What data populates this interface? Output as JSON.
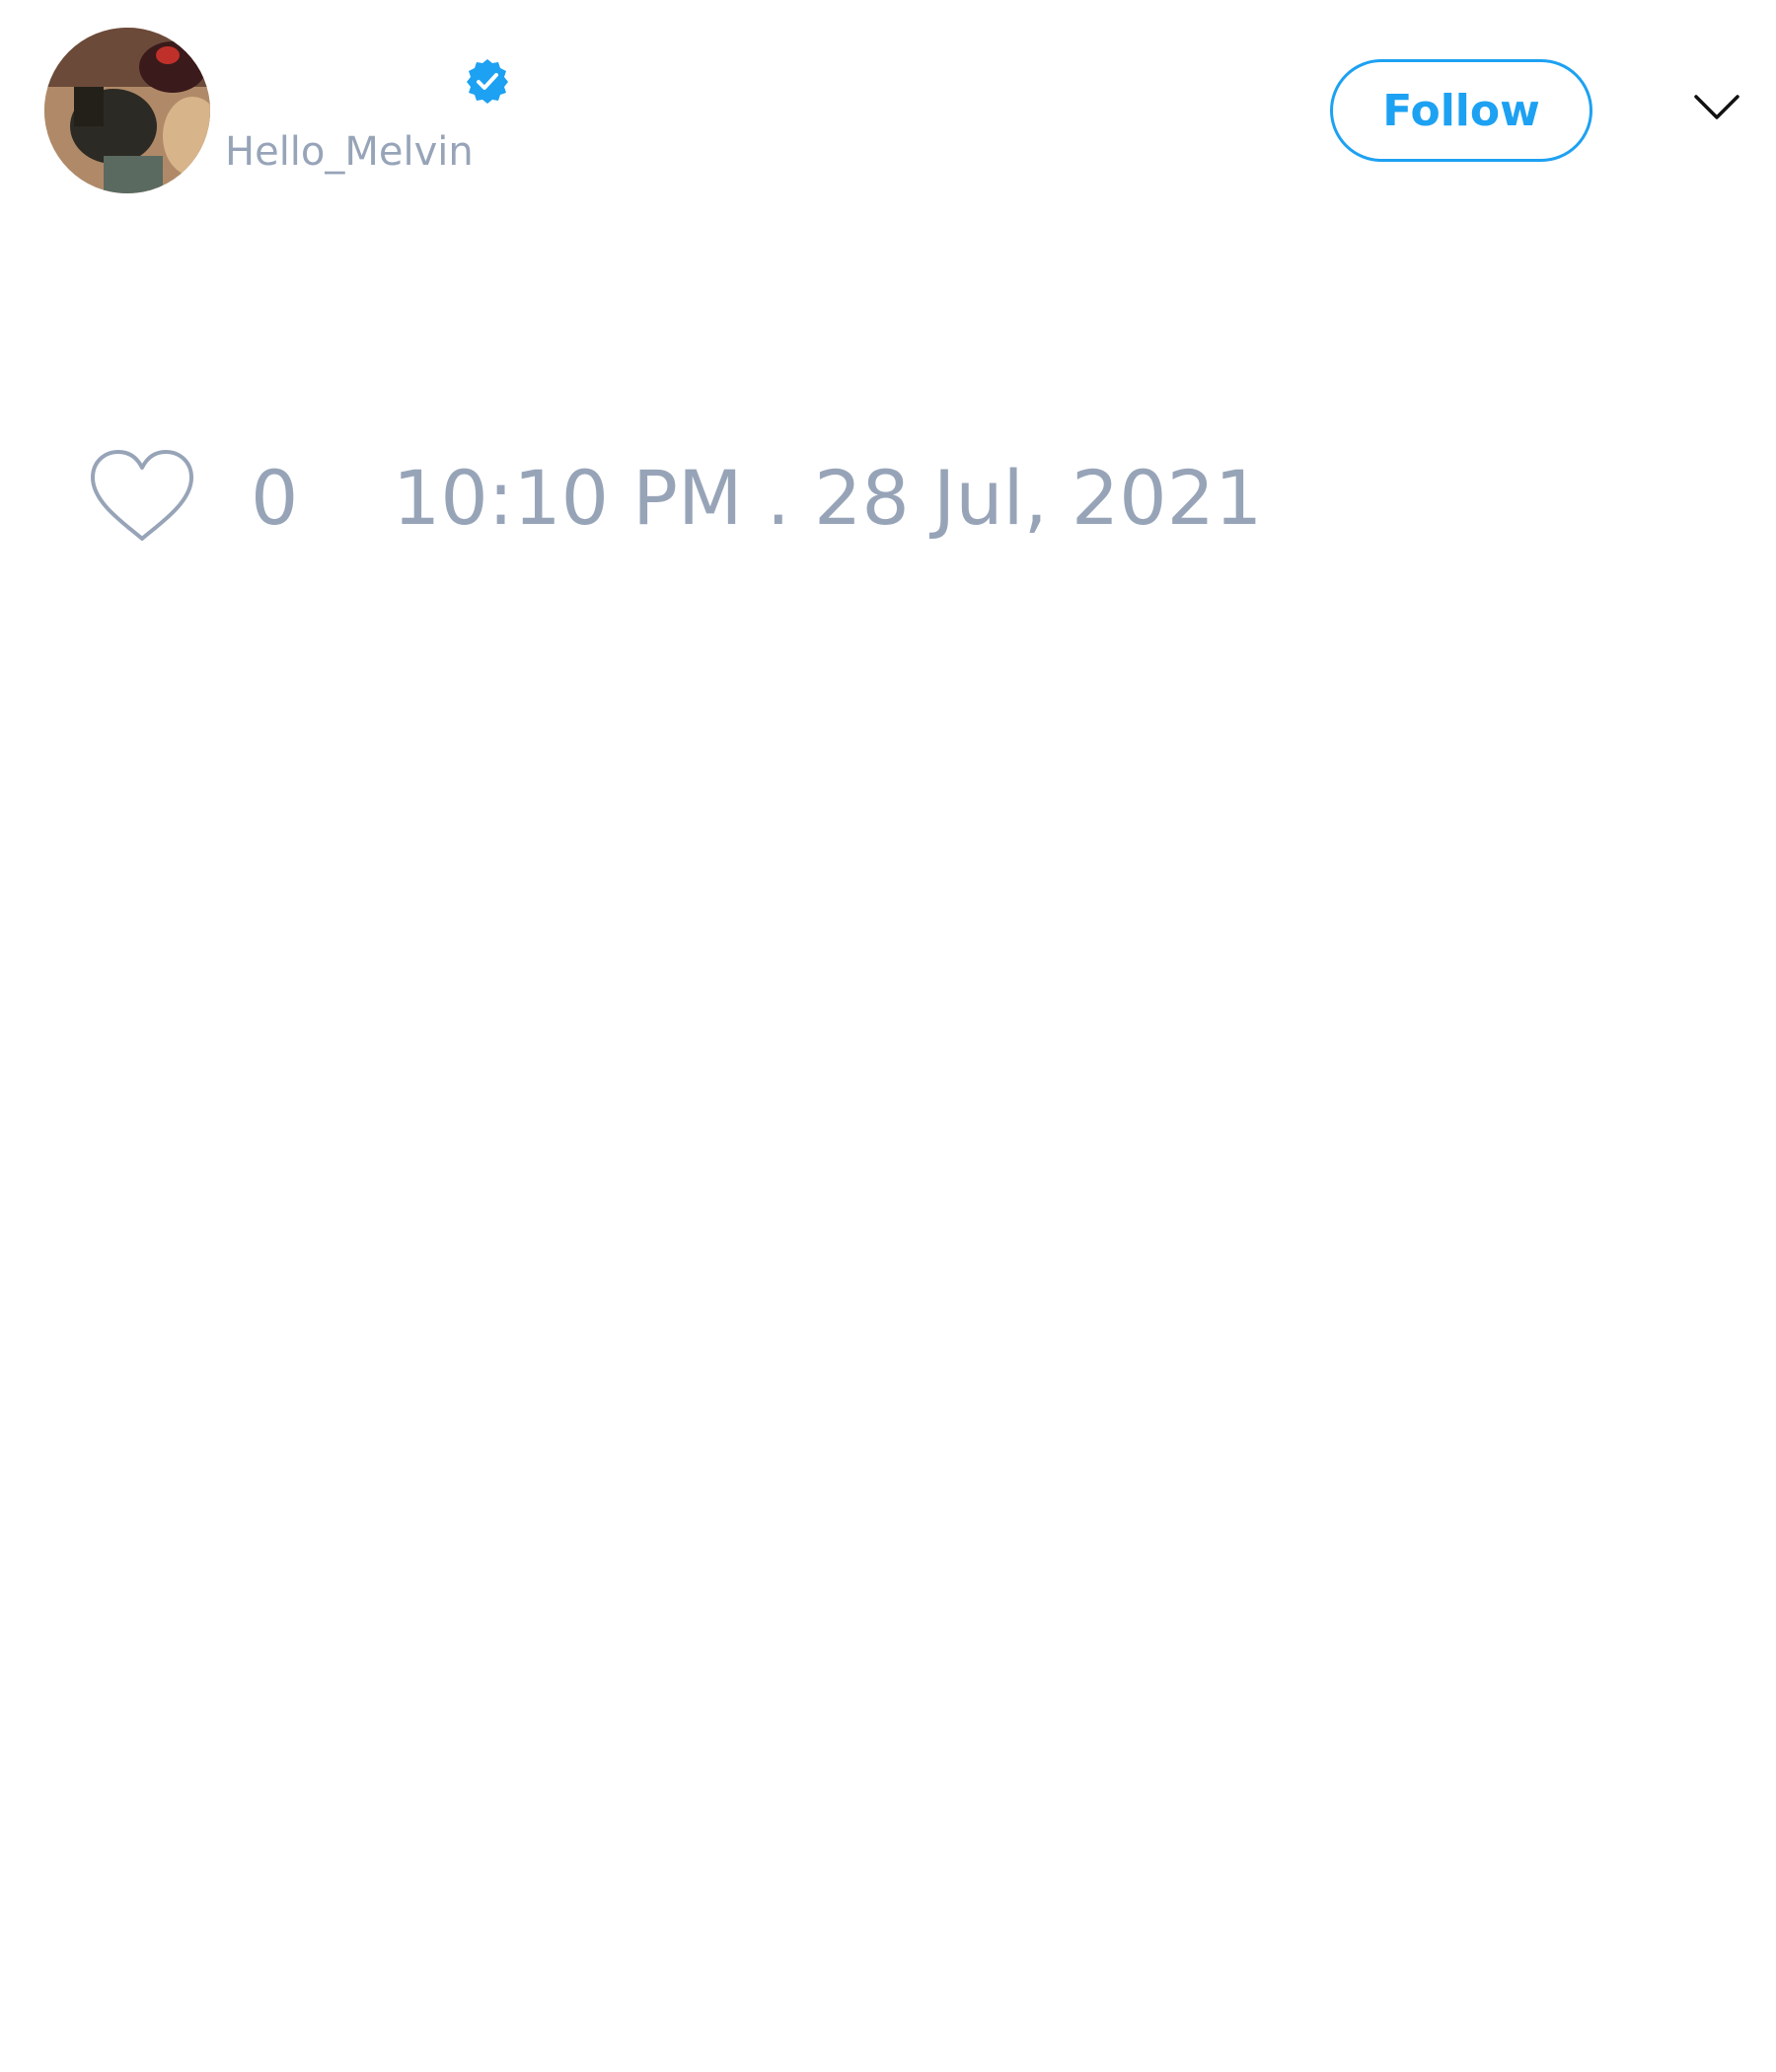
{
  "tweet": {
    "author": {
      "handle": "Hello_Melvin",
      "verified": true,
      "avatar_icon": "profile-photo"
    },
    "follow_label": "Follow",
    "menu_icon": "chevron-down-icon",
    "like_icon": "heart-outline-icon",
    "like_count": "0",
    "timestamp": "10:10 PM . 28 Jul, 2021"
  },
  "colors": {
    "accent": "#1da1f2",
    "muted_text": "#97a4b8",
    "background": "#ffffff"
  }
}
